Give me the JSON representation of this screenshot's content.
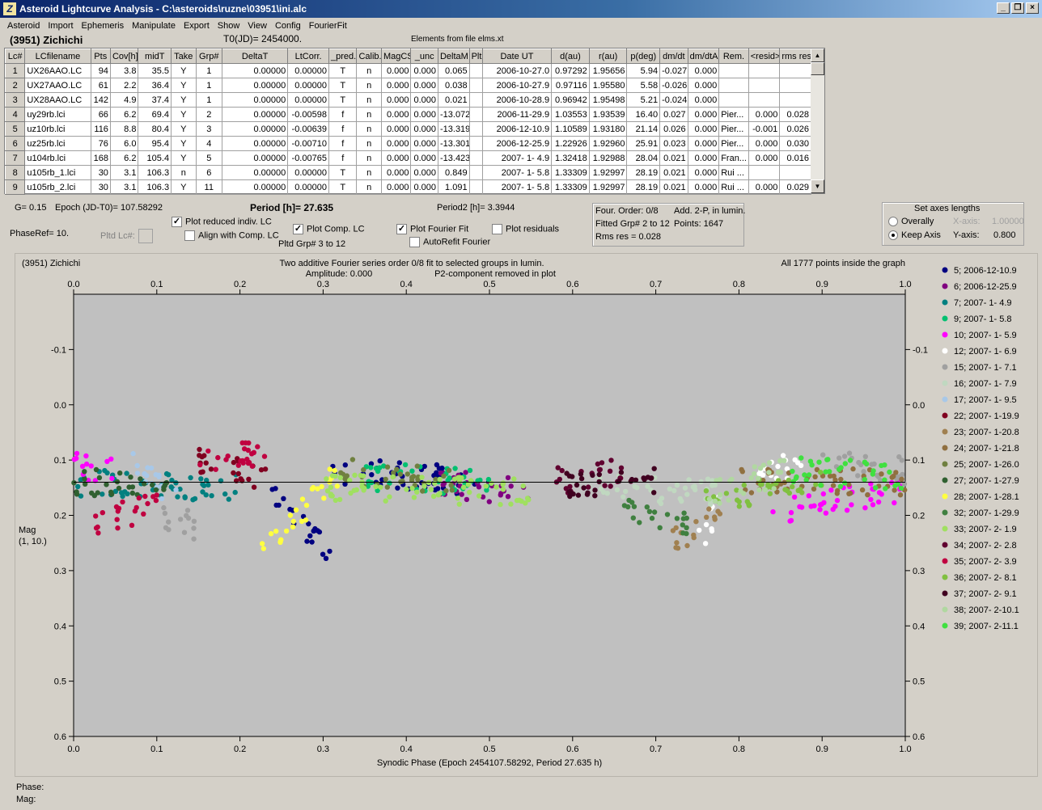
{
  "window": {
    "title": "Asteroid Lightcurve Analysis - C:\\asteroids\\ruzne\\03951\\ini.alc",
    "icon_letter": "Z",
    "buttons": {
      "minimize": "_",
      "restore": "❐",
      "close": "×"
    }
  },
  "menu": [
    "Asteroid",
    "Import",
    "Ephemeris",
    "Manipulate",
    "Export",
    "Show",
    "View",
    "Config",
    "FourierFit"
  ],
  "info": {
    "asteroid": "(3951) Zichichi",
    "t0": "T0(JD)= 2454000.",
    "elements": "Elements from file elms.xt"
  },
  "table": {
    "headers": [
      "Lc#",
      "LCfilename",
      "Pts",
      "Cov[h]",
      "midT",
      "Take",
      "Grp#",
      "DeltaT",
      "LtCorr.",
      "_pred.",
      "Calib.",
      "MagCS",
      "_unc",
      "DeltaM",
      "Plt",
      "Date UT",
      "d(au)",
      "r(au)",
      "p(deg)",
      "dm/dt",
      "dm/dtA",
      "Rem.",
      "<resid>",
      "rms res"
    ],
    "rows": [
      [
        "1",
        "UX26AAO.LC",
        "94",
        "3.8",
        "35.5",
        "Y",
        "1",
        "0.00000",
        "0.00000",
        "T",
        "n",
        "0.000",
        "0.000",
        "0.065",
        "",
        "2006-10-27.0",
        "0.97292",
        "1.95656",
        "5.94",
        "-0.027",
        "0.000",
        "",
        "",
        ""
      ],
      [
        "2",
        "UX27AAO.LC",
        "61",
        "2.2",
        "36.4",
        "Y",
        "1",
        "0.00000",
        "0.00000",
        "T",
        "n",
        "0.000",
        "0.000",
        "0.038",
        "",
        "2006-10-27.9",
        "0.97116",
        "1.95580",
        "5.58",
        "-0.026",
        "0.000",
        "",
        "",
        ""
      ],
      [
        "3",
        "UX28AAO.LC",
        "142",
        "4.9",
        "37.4",
        "Y",
        "1",
        "0.00000",
        "0.00000",
        "T",
        "n",
        "0.000",
        "0.000",
        "0.021",
        "",
        "2006-10-28.9",
        "0.96942",
        "1.95498",
        "5.21",
        "-0.024",
        "0.000",
        "",
        "",
        ""
      ],
      [
        "4",
        "uy29rb.lci",
        "66",
        "6.2",
        "69.4",
        "Y",
        "2",
        "0.00000",
        "-0.00598",
        "f",
        "n",
        "0.000",
        "0.000",
        "-13.072",
        "",
        "2006-11-29.9",
        "1.03553",
        "1.93539",
        "16.40",
        "0.027",
        "0.000",
        "Pier...",
        "0.000",
        "0.028"
      ],
      [
        "5",
        "uz10rb.lci",
        "116",
        "8.8",
        "80.4",
        "Y",
        "3",
        "0.00000",
        "-0.00639",
        "f",
        "n",
        "0.000",
        "0.000",
        "-13.319",
        "",
        "2006-12-10.9",
        "1.10589",
        "1.93180",
        "21.14",
        "0.026",
        "0.000",
        "Pier...",
        "-0.001",
        "0.026"
      ],
      [
        "6",
        "uz25rb.lci",
        "76",
        "6.0",
        "95.4",
        "Y",
        "4",
        "0.00000",
        "-0.00710",
        "f",
        "n",
        "0.000",
        "0.000",
        "-13.301",
        "",
        "2006-12-25.9",
        "1.22926",
        "1.92960",
        "25.91",
        "0.023",
        "0.000",
        "Pier...",
        "0.000",
        "0.030"
      ],
      [
        "7",
        "u104rb.lci",
        "168",
        "6.2",
        "105.4",
        "Y",
        "5",
        "0.00000",
        "-0.00765",
        "f",
        "n",
        "0.000",
        "0.000",
        "-13.423",
        "",
        "2007- 1- 4.9",
        "1.32418",
        "1.92988",
        "28.04",
        "0.021",
        "0.000",
        "Fran...",
        "0.000",
        "0.016"
      ],
      [
        "8",
        "u105rb_1.lci",
        "30",
        "3.1",
        "106.3",
        "n",
        "6",
        "0.00000",
        "0.00000",
        "T",
        "n",
        "0.000",
        "0.000",
        "0.849",
        "",
        "2007- 1- 5.8",
        "1.33309",
        "1.92997",
        "28.19",
        "0.021",
        "0.000",
        "Rui ...",
        "",
        ""
      ],
      [
        "9",
        "u105rb_2.lci",
        "30",
        "3.1",
        "106.3",
        "Y",
        "11",
        "0.00000",
        "0.00000",
        "T",
        "n",
        "0.000",
        "0.000",
        "1.091",
        "",
        "2007- 1- 5.8",
        "1.33309",
        "1.92997",
        "28.19",
        "0.021",
        "0.000",
        "Rui ...",
        "0.000",
        "0.029"
      ]
    ]
  },
  "controls": {
    "g": "G= 0.15",
    "epoch": "Epoch (JD-T0)= 107.58292",
    "period": "Period [h]= 27.635",
    "period2": "Period2 [h]= 3.3944",
    "phaseref": "PhaseRef= 10.",
    "pltd_lc": "Pltd Lc#:",
    "plot_reduced": "Plot reduced indiv. LC",
    "align_comp": "Align with Comp. LC",
    "plot_comp": "Plot Comp. LC",
    "pltd_grp": "Pltd Grp#  3  to  12",
    "plot_fourier": "Plot Fourier Fit",
    "autorefit": "AutoRefit Fourier",
    "plot_residuals": "Plot residuals",
    "checked": {
      "plot_reduced": true,
      "align_comp": false,
      "plot_comp": true,
      "plot_fourier": true,
      "autorefit": false,
      "plot_residuals": false
    }
  },
  "fit_info": {
    "order": "Four. Order:  0/8",
    "add": "Add. 2-P, in lumin.",
    "fitted": "Fitted Grp# 2 to 12",
    "points": "Points: 1647",
    "rms": "Rms res     = 0.028"
  },
  "axes_box": {
    "title": "Set axes lengths",
    "overally": "Overally",
    "keep_axis": "Keep Axis",
    "x_axis_label": "X-axis:",
    "x_axis_value": "1.00000",
    "y_axis_label": "Y-axis:",
    "y_axis_value": "0.800",
    "selected": "Keep Axis"
  },
  "plot_header": {
    "left": "(3951) Zichichi",
    "center1": "Two additive Fourier series order 0/8 fit to selected groups in lumin.",
    "center2a": "Amplitude: 0.000",
    "center2b": "P2-component removed in plot",
    "right": "All 1777 points inside the graph"
  },
  "chart_data": {
    "type": "scatter",
    "xlabel": "Synodic Phase (Epoch 2454107.58292, Period 27.635 h)",
    "ylabel": "Mag",
    "ylabel2": "(1, 10.)",
    "xlim": [
      0.0,
      1.0
    ],
    "ylim": [
      -0.2,
      0.6
    ],
    "y_inverted": true,
    "x_ticks": [
      "0.0",
      "0.1",
      "0.2",
      "0.3",
      "0.4",
      "0.5",
      "0.6",
      "0.7",
      "0.8",
      "0.9",
      "1.0"
    ],
    "y_ticks": [
      "-0.1",
      "0.0",
      "0.1",
      "0.2",
      "0.3",
      "0.4",
      "0.5",
      "0.6"
    ],
    "fit_line_y": 0.14,
    "legend_position": "right",
    "series": [
      {
        "name": "5; 2006-12-10.9",
        "color": "#000080",
        "segments": [
          [
            0.23,
            0.31,
            0.14,
            0.27
          ],
          [
            0.31,
            0.5,
            0.12,
            0.14
          ]
        ]
      },
      {
        "name": "6; 2006-12-25.9",
        "color": "#800080",
        "segments": [
          [
            0.43,
            0.55,
            0.14,
            0.16
          ]
        ]
      },
      {
        "name": "7; 2007- 1- 4.9",
        "color": "#008080",
        "segments": [
          [
            0.0,
            0.2,
            0.14,
            0.15
          ]
        ]
      },
      {
        "name": "9; 2007- 1- 5.8",
        "color": "#00c070",
        "segments": [
          [
            0.35,
            0.5,
            0.13,
            0.14
          ]
        ]
      },
      {
        "name": "10; 2007- 1- 5.9",
        "color": "#ff00ff",
        "segments": [
          [
            0.0,
            0.05,
            0.11,
            0.12
          ],
          [
            0.84,
            1.0,
            0.2,
            0.15
          ]
        ]
      },
      {
        "name": "12; 2007- 1- 6.9",
        "color": "#ffffff",
        "segments": [
          [
            0.75,
            0.78,
            0.25,
            0.18
          ],
          [
            0.82,
            0.88,
            0.11,
            0.12
          ]
        ]
      },
      {
        "name": "15; 2007- 1- 7.1",
        "color": "#a0a0a0",
        "segments": [
          [
            0.1,
            0.15,
            0.2,
            0.22
          ],
          [
            0.9,
            1.0,
            0.1,
            0.12
          ]
        ]
      },
      {
        "name": "16; 2007- 1- 7.9",
        "color": "#c0d8c0",
        "segments": [
          [
            0.62,
            0.78,
            0.15,
            0.16
          ]
        ]
      },
      {
        "name": "17; 2007- 1- 9.5",
        "color": "#a8c8e8",
        "segments": [
          [
            0.07,
            0.13,
            0.1,
            0.18
          ]
        ]
      },
      {
        "name": "22; 2007- 1-19.9",
        "color": "#800020",
        "segments": [
          [
            0.15,
            0.24,
            0.1,
            0.14
          ]
        ]
      },
      {
        "name": "23; 2007- 1-20.8",
        "color": "#a08050",
        "segments": [
          [
            0.72,
            0.78,
            0.25,
            0.2
          ]
        ]
      },
      {
        "name": "24; 2007- 1-21.8",
        "color": "#907040",
        "segments": [
          [
            0.8,
            1.0,
            0.14,
            0.14
          ]
        ]
      },
      {
        "name": "25; 2007- 1-26.0",
        "color": "#708040",
        "segments": [
          [
            0.32,
            0.46,
            0.12,
            0.14
          ]
        ]
      },
      {
        "name": "27; 2007- 1-27.9",
        "color": "#306030",
        "segments": [
          [
            0.0,
            0.12,
            0.14,
            0.15
          ]
        ]
      },
      {
        "name": "28; 2007- 1-28.1",
        "color": "#ffff40",
        "segments": [
          [
            0.22,
            0.32,
            0.28,
            0.12
          ]
        ]
      },
      {
        "name": "32; 2007- 1-29.9",
        "color": "#408040",
        "segments": [
          [
            0.66,
            0.74,
            0.18,
            0.22
          ]
        ]
      },
      {
        "name": "33; 2007- 2- 1.9",
        "color": "#a0e060",
        "segments": [
          [
            0.3,
            0.56,
            0.15,
            0.16
          ]
        ]
      },
      {
        "name": "34; 2007- 2- 2.8",
        "color": "#600030",
        "segments": [
          [
            0.57,
            0.66,
            0.14,
            0.12
          ]
        ]
      },
      {
        "name": "35; 2007- 2- 3.9",
        "color": "#c00040",
        "segments": [
          [
            0.02,
            0.1,
            0.22,
            0.18
          ],
          [
            0.14,
            0.23,
            0.1,
            0.09
          ]
        ]
      },
      {
        "name": "36; 2007- 2- 8.1",
        "color": "#80c040",
        "segments": [
          [
            0.76,
            0.9,
            0.18,
            0.13
          ]
        ]
      },
      {
        "name": "37; 2007- 2- 9.1",
        "color": "#400020",
        "segments": [
          [
            0.58,
            0.7,
            0.15,
            0.14
          ]
        ]
      },
      {
        "name": "38; 2007- 2-10.1",
        "color": "#b0d8a0",
        "segments": [
          [
            0.76,
            0.86,
            0.16,
            0.12
          ]
        ]
      },
      {
        "name": "39; 2007- 2-11.1",
        "color": "#40e040",
        "segments": [
          [
            0.86,
            1.0,
            0.12,
            0.13
          ]
        ]
      }
    ]
  },
  "status": {
    "phase": "Phase:",
    "mag": "Mag:"
  }
}
